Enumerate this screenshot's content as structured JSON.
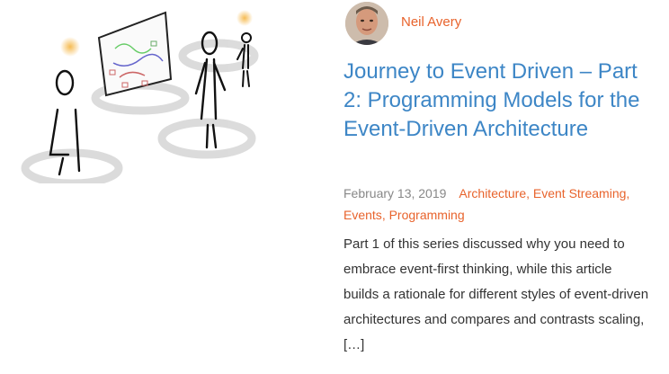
{
  "post": {
    "author": {
      "name": "Neil Avery",
      "avatar_icon": "author-avatar"
    },
    "title": "Journey to Event Driven – Part 2: Programming Models for the Event-Driven Architecture",
    "date": "February 13, 2019",
    "categories": [
      {
        "label": "Architecture"
      },
      {
        "label": "Event Streaming"
      },
      {
        "label": "Events"
      },
      {
        "label": "Programming"
      }
    ],
    "separator": ",",
    "excerpt": "Part 1 of this series discussed why you need to embrace event-first thinking, while this article builds a rationale for different styles of event-driven architectures and compares and contrasts scaling, […]"
  },
  "colors": {
    "title": "#3d86c6",
    "accent": "#e8632c",
    "date": "#888888",
    "body_text": "#333333"
  }
}
